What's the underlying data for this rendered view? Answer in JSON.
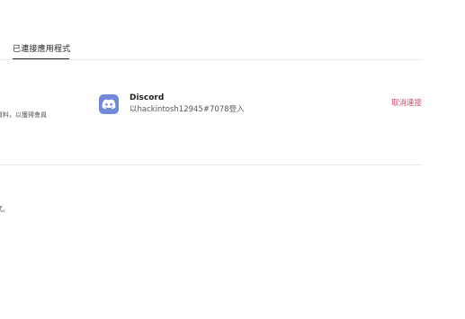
{
  "tabs": {
    "connected_apps_label": "已連接應用程式"
  },
  "left_panel": {
    "description_fragment_1": "資料，以獲得會員",
    "description_fragment_2": "式。"
  },
  "connected_app": {
    "icon": "discord-logo-icon",
    "icon_color": "#7289da",
    "name": "Discord",
    "detail": "以hackintosh12945#7078登入",
    "disconnect_label": "取消連接",
    "disconnect_color": "#c6526a"
  }
}
